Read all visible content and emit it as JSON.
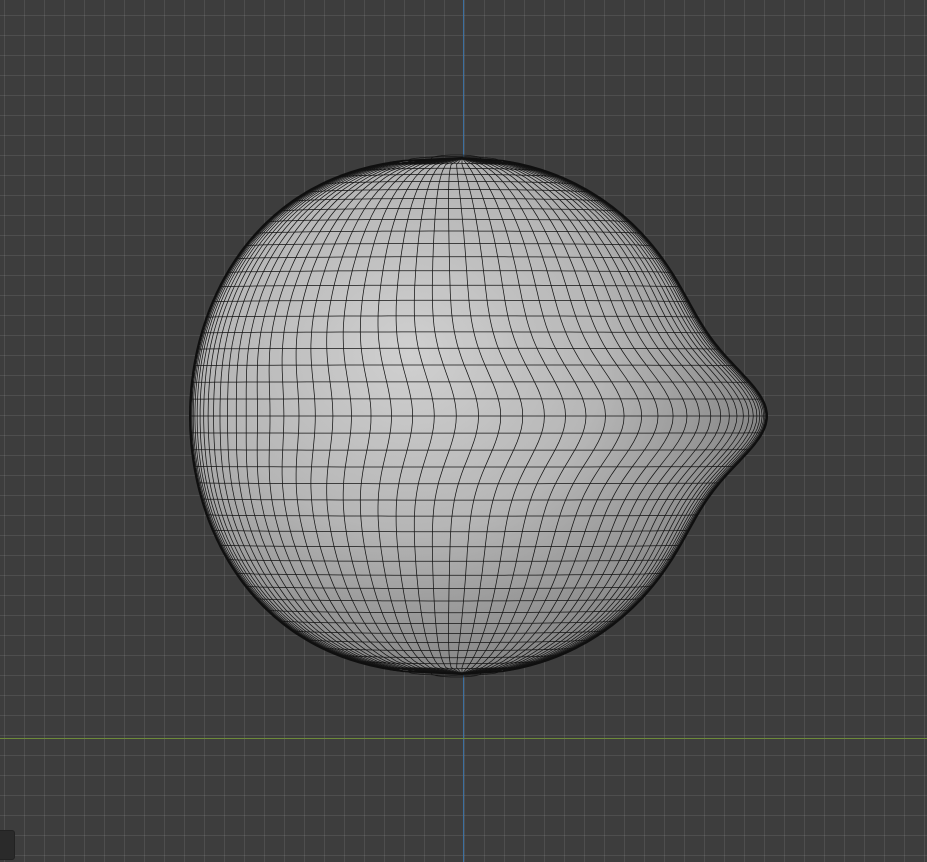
{
  "viewport": {
    "background": "#3d3d3d",
    "grid": true,
    "axes": {
      "y_axis_color": "#3b6fa0",
      "x_axis_color": "#6d8a3a"
    }
  },
  "object": {
    "shape": "uv-sphere-deformed",
    "shading": "solid",
    "wireframe_overlay": true,
    "surface_color": "#bdbdbd",
    "wire_color": "#141414"
  },
  "corner_widget": {
    "icon": "viewport-corner-handle"
  }
}
